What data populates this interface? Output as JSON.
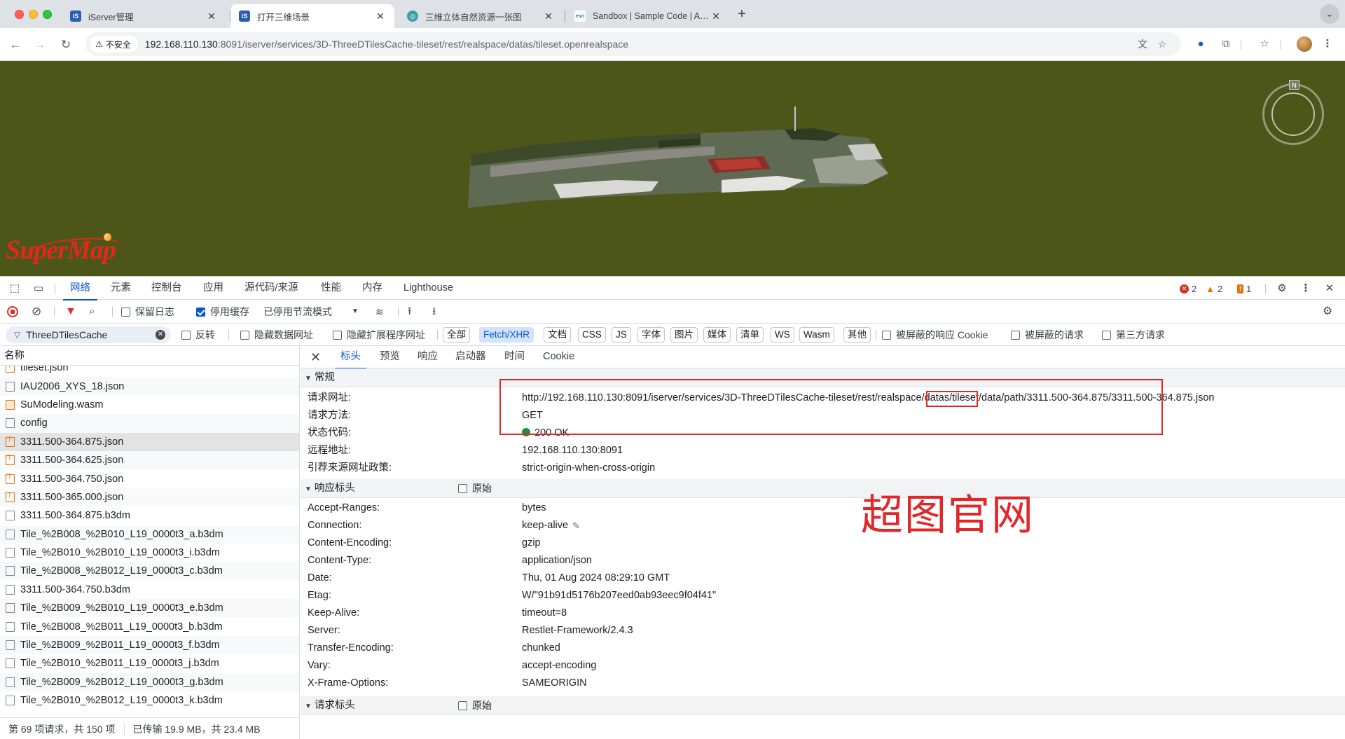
{
  "browser": {
    "tabs": [
      {
        "title": "iServer管理",
        "favicon": "iS",
        "color": "#2a5db0"
      },
      {
        "title": "打开三维场景",
        "favicon": "iS",
        "color": "#2a5db0"
      },
      {
        "title": "三维立体自然资源一张图",
        "favicon": "◎",
        "color": "#3aa0a8"
      },
      {
        "title": "Sandbox | Sample Code | ArcG",
        "favicon": "esri",
        "color": "#ffffff"
      }
    ],
    "security_label": "不安全",
    "url_host": "192.168.110.130",
    "url_rest": ":8091/iserver/services/3D-ThreeDTilesCache-tileset/rest/realspace/datas/tileset.openrealspace"
  },
  "viewer": {
    "compass_label": "N",
    "logo_text": "SuperMap"
  },
  "devtools": {
    "tabs": [
      "网络",
      "元素",
      "控制台",
      "应用",
      "源代码/来源",
      "性能",
      "内存",
      "Lighthouse"
    ],
    "active_tab": "网络",
    "counts": {
      "errors": "2",
      "warnings": "2",
      "issues": "1"
    },
    "toolbar": {
      "preserve_log": "保留日志",
      "disable_cache": "停用缓存",
      "throttle": "已停用节流模式"
    },
    "filter": {
      "value": "ThreeDTilesCache",
      "invert": "反转",
      "hide_data_urls": "隐藏数据网址",
      "hide_ext_urls": "隐藏扩展程序网址",
      "types": [
        "全部",
        "Fetch/XHR",
        "文档",
        "CSS",
        "JS",
        "字体",
        "图片",
        "媒体",
        "清单",
        "WS",
        "Wasm",
        "其他"
      ],
      "active_type": "Fetch/XHR",
      "blocked_cookies": "被屏蔽的响应 Cookie",
      "blocked_requests": "被屏蔽的请求",
      "third_party": "第三方请求"
    },
    "list": {
      "header": "名称",
      "rows": [
        {
          "name": "tileset.json",
          "type": "json"
        },
        {
          "name": "IAU2006_XYS_18.json",
          "type": "doc"
        },
        {
          "name": "SuModeling.wasm",
          "type": "wasm"
        },
        {
          "name": "config",
          "type": "doc"
        },
        {
          "name": "3311.500-364.875.json",
          "type": "json",
          "selected": true
        },
        {
          "name": "3311.500-364.625.json",
          "type": "json"
        },
        {
          "name": "3311.500-364.750.json",
          "type": "json"
        },
        {
          "name": "3311.500-365.000.json",
          "type": "json"
        },
        {
          "name": "3311.500-364.875.b3dm",
          "type": "doc"
        },
        {
          "name": "Tile_%2B008_%2B010_L19_0000t3_a.b3dm",
          "type": "doc"
        },
        {
          "name": "Tile_%2B010_%2B010_L19_0000t3_i.b3dm",
          "type": "doc"
        },
        {
          "name": "Tile_%2B008_%2B012_L19_0000t3_c.b3dm",
          "type": "doc"
        },
        {
          "name": "3311.500-364.750.b3dm",
          "type": "doc"
        },
        {
          "name": "Tile_%2B009_%2B010_L19_0000t3_e.b3dm",
          "type": "doc"
        },
        {
          "name": "Tile_%2B008_%2B011_L19_0000t3_b.b3dm",
          "type": "doc"
        },
        {
          "name": "Tile_%2B009_%2B011_L19_0000t3_f.b3dm",
          "type": "doc"
        },
        {
          "name": "Tile_%2B010_%2B011_L19_0000t3_j.b3dm",
          "type": "doc"
        },
        {
          "name": "Tile_%2B009_%2B012_L19_0000t3_g.b3dm",
          "type": "doc"
        },
        {
          "name": "Tile_%2B010_%2B012_L19_0000t3_k.b3dm",
          "type": "doc"
        }
      ],
      "status_requests": "第 69 项请求，共 150 项",
      "status_transfer": "已传输 19.9 MB，共 23.4 MB"
    },
    "detail": {
      "tabs": [
        "标头",
        "预览",
        "响应",
        "启动器",
        "时间",
        "Cookie"
      ],
      "active_tab": "标头",
      "general_title": "常规",
      "general": [
        {
          "k": "请求网址:",
          "v": "http://192.168.110.130:8091/iserver/services/3D-ThreeDTilesCache-tileset/rest/realspace/datas/tileset/data/path/3311.500-364.875/3311.500-364.875.json"
        },
        {
          "k": "请求方法:",
          "v": "GET"
        },
        {
          "k": "状态代码:",
          "v": "200 OK"
        },
        {
          "k": "远程地址:",
          "v": "192.168.110.130:8091"
        },
        {
          "k": "引荐来源网址政策:",
          "v": "strict-origin-when-cross-origin"
        }
      ],
      "response_title": "响应标头",
      "raw_label": "原始",
      "response": [
        {
          "k": "Accept-Ranges:",
          "v": "bytes"
        },
        {
          "k": "Connection:",
          "v": "keep-alive"
        },
        {
          "k": "Content-Encoding:",
          "v": "gzip"
        },
        {
          "k": "Content-Type:",
          "v": "application/json"
        },
        {
          "k": "Date:",
          "v": "Thu, 01 Aug 2024 08:29:10 GMT"
        },
        {
          "k": "Etag:",
          "v": "W/\"91b91d5176b207eed0ab93eec9f04f41\""
        },
        {
          "k": "Keep-Alive:",
          "v": "timeout=8"
        },
        {
          "k": "Server:",
          "v": "Restlet-Framework/2.4.3"
        },
        {
          "k": "Transfer-Encoding:",
          "v": "chunked"
        },
        {
          "k": "Vary:",
          "v": "accept-encoding"
        },
        {
          "k": "X-Frame-Options:",
          "v": "SAMEORIGIN"
        }
      ],
      "request_title": "请求标头",
      "watermark": "超图官网"
    }
  }
}
